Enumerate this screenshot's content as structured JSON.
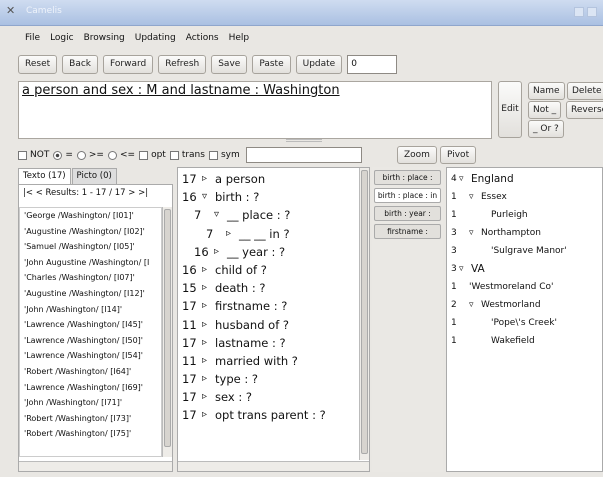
{
  "window": {
    "title": "Camelis"
  },
  "menu": [
    "File",
    "Logic",
    "Browsing",
    "Updating",
    "Actions",
    "Help"
  ],
  "toolbar": {
    "buttons": [
      "Reset",
      "Back",
      "Forward",
      "Refresh",
      "Save",
      "Paste",
      "Update"
    ],
    "number_value": "0"
  },
  "query": {
    "text": "a person and sex : M and lastname : Washington"
  },
  "query_buttons": {
    "edit": "Edit",
    "name": "Name",
    "delete": "Delete",
    "not": "Not _",
    "reverse": "Reverse",
    "or": "_ Or ?"
  },
  "options": {
    "not": "NOT",
    "eq": "=",
    "ge": ">=",
    "le": "<=",
    "opt": "opt",
    "trans": "trans",
    "sym": "sym",
    "zoom": "Zoom",
    "pivot": "Pivot"
  },
  "tabs": [
    "Texto (17)",
    "Picto (0)"
  ],
  "results": {
    "nav": "|<  < Results: 1 - 17 / 17 >  >|",
    "items": [
      "'George /Washington/ [I01]'",
      "'Augustine /Washington/ [I02]'",
      "'Samuel /Washington/ [I05]'",
      "'John Augustine /Washington/ [I",
      "'Charles /Washington/ [I07]'",
      "'Augustine /Washington/ [I12]'",
      "'John /Washington/ [I14]'",
      "'Lawrence /Washington/ [I45]'",
      "'Lawrence /Washington/ [I50]'",
      "'Lawrence /Washington/ [I54]'",
      "'Robert /Washington/ [I64]'",
      "'Lawrence /Washington/ [I69]'",
      "'John /Washington/ [I71]'",
      "'Robert /Washington/ [I73]'",
      "'Robert /Washington/ [I75]'"
    ]
  },
  "tree": [
    {
      "count": "17",
      "arrow": "▹",
      "label": "a person",
      "indent": 0
    },
    {
      "count": "16",
      "arrow": "▿",
      "label": "birth : ?",
      "indent": 0
    },
    {
      "count": "7",
      "arrow": "▿",
      "label": "__ place : ?",
      "indent": 1
    },
    {
      "count": "7",
      "arrow": "▹",
      "label": "__ __ in ?",
      "indent": 2
    },
    {
      "count": "16",
      "arrow": "▹",
      "label": "__ year : ?",
      "indent": 1
    },
    {
      "count": "16",
      "arrow": "▹",
      "label": "child of ?",
      "indent": 0
    },
    {
      "count": "15",
      "arrow": "▹",
      "label": "death : ?",
      "indent": 0
    },
    {
      "count": "17",
      "arrow": "▹",
      "label": "firstname : ?",
      "indent": 0
    },
    {
      "count": "11",
      "arrow": "▹",
      "label": "husband of ?",
      "indent": 0
    },
    {
      "count": "17",
      "arrow": "▹",
      "label": "lastname : ?",
      "indent": 0
    },
    {
      "count": "11",
      "arrow": "▹",
      "label": "married with ?",
      "indent": 0
    },
    {
      "count": "17",
      "arrow": "▹",
      "label": "type : ?",
      "indent": 0
    },
    {
      "count": "17",
      "arrow": "▹",
      "label": "sex : ?",
      "indent": 0
    },
    {
      "count": "17",
      "arrow": "▹",
      "label": "opt trans parent : ?",
      "indent": 0
    }
  ],
  "facets": [
    "birth : place :",
    "birth : place : in",
    "birth : year :",
    "firstname :"
  ],
  "values": [
    {
      "count": "4",
      "arrow": "▿",
      "label": "England",
      "level": 0
    },
    {
      "count": "1",
      "arrow": "▿",
      "label": "Essex",
      "level": 1
    },
    {
      "count": "1",
      "arrow": "",
      "label": "Purleigh",
      "level": 2
    },
    {
      "count": "3",
      "arrow": "▿",
      "label": "Northampton",
      "level": 1
    },
    {
      "count": "3",
      "arrow": "",
      "label": "'Sulgrave Manor'",
      "level": 2
    },
    {
      "count": "3",
      "arrow": "▿",
      "label": "VA",
      "level": 0
    },
    {
      "count": "1",
      "arrow": "",
      "label": "'Westmoreland Co'",
      "level": 1
    },
    {
      "count": "2",
      "arrow": "▿",
      "label": "Westmorland",
      "level": 1
    },
    {
      "count": "1",
      "arrow": "",
      "label": "'Pope\\'s Creek'",
      "level": 2
    },
    {
      "count": "1",
      "arrow": "",
      "label": "Wakefield",
      "level": 2
    }
  ]
}
